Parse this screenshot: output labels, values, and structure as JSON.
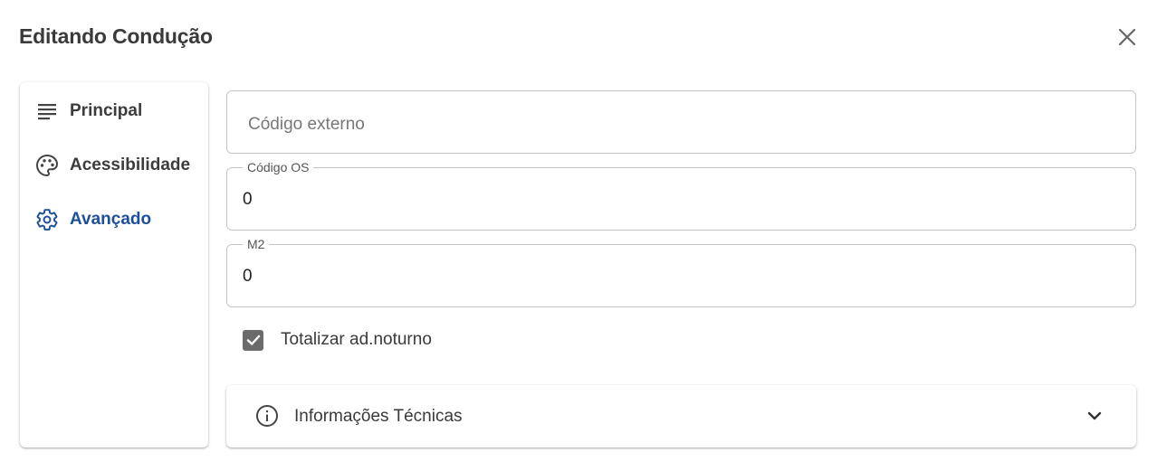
{
  "dialog": {
    "title": "Editando Condução"
  },
  "nav": {
    "items": [
      {
        "label": "Principal",
        "icon": "lines-icon",
        "active": false
      },
      {
        "label": "Acessibilidade",
        "icon": "palette-icon",
        "active": false
      },
      {
        "label": "Avançado",
        "icon": "gear-icon",
        "active": true
      }
    ]
  },
  "form": {
    "codigo_externo": {
      "placeholder": "Código externo",
      "value": ""
    },
    "codigo_os": {
      "label": "Código OS",
      "value": "0"
    },
    "m2": {
      "label": "M2",
      "value": "0"
    },
    "totalizar": {
      "label": "Totalizar ad.noturno",
      "checked": true
    }
  },
  "accordion": {
    "label": "Informações Técnicas",
    "expanded": false
  },
  "colors": {
    "accent": "#1e4f9c",
    "checkbox": "#6b6b6b",
    "border": "#c4c4c4"
  }
}
